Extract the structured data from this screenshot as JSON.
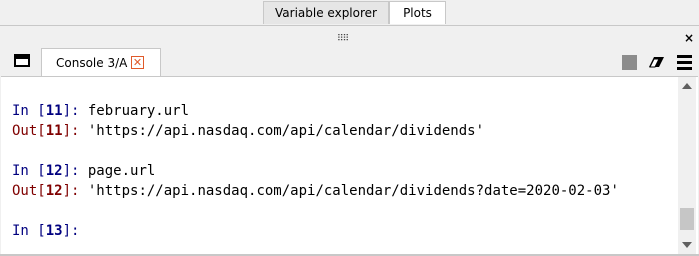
{
  "top_tabs": {
    "variable_explorer": "Variable explorer",
    "plots": "Plots"
  },
  "drag_handle": "⠿⠿",
  "pane_close": "×",
  "console_tab": {
    "label": "Console 3/A",
    "close": "✕"
  },
  "console": {
    "lines": [
      {
        "type": "in",
        "prompt_open": "In [",
        "num": "11",
        "prompt_close": "]: ",
        "text": "february.url"
      },
      {
        "type": "out",
        "prompt_open": "Out[",
        "num": "11",
        "prompt_close": "]: ",
        "text": "'https://api.nasdaq.com/api/calendar/dividends'"
      },
      {
        "type": "blank"
      },
      {
        "type": "in",
        "prompt_open": "In [",
        "num": "12",
        "prompt_close": "]: ",
        "text": "page.url"
      },
      {
        "type": "out",
        "prompt_open": "Out[",
        "num": "12",
        "prompt_close": "]: ",
        "text": "'https://api.nasdaq.com/api/calendar/dividends?date=2020-02-03'"
      },
      {
        "type": "blank"
      },
      {
        "type": "in",
        "prompt_open": "In [",
        "num": "13",
        "prompt_close": "]: ",
        "text": ""
      }
    ]
  },
  "colors": {
    "in_prompt": "#00007f",
    "out_prompt": "#7f0000",
    "tab_close": "#e05a2a"
  }
}
